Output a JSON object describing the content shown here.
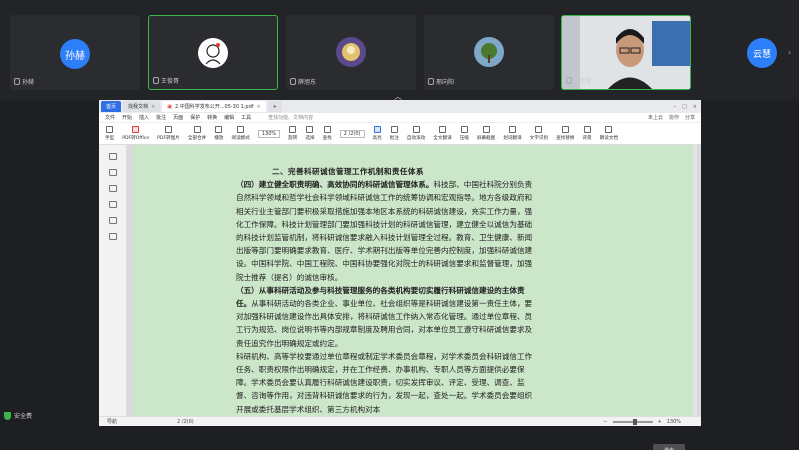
{
  "participants": [
    {
      "name": "孙赫",
      "avatar_text": "孙赫",
      "type": "initials"
    },
    {
      "name": "王俊哥",
      "type": "image"
    },
    {
      "name": "薛旭东",
      "type": "image"
    },
    {
      "name": "邢向阳",
      "type": "image"
    },
    {
      "name": "张金星",
      "type": "video",
      "active": true
    }
  ],
  "side_avatar": "云慧",
  "window": {
    "tabs": [
      "首页",
      "找我文档",
      "2.中国科学发布公开...05-30 1.pdf"
    ],
    "menu": [
      "文件",
      "开始",
      "插入",
      "批注",
      "页面",
      "保护",
      "转换",
      "编辑",
      "工具"
    ],
    "menu_highlight": "开始",
    "search_placeholder": "查找功能、文档内容",
    "menu_right": [
      "未上云",
      "协作",
      "分享"
    ],
    "toolbar": [
      {
        "label": "手型",
        "style": "plain"
      },
      {
        "label": "PDF转Office",
        "style": "red"
      },
      {
        "label": "PDF转图片",
        "style": "plain"
      },
      {
        "label": "全部合并",
        "style": "plain"
      },
      {
        "label": "播放",
        "style": "plain"
      },
      {
        "label": "阅读模式",
        "style": "plain"
      },
      {
        "label": "旋转",
        "style": "plain"
      },
      {
        "label": "选择",
        "style": "plain"
      },
      {
        "label": "查找",
        "style": "plain"
      },
      {
        "label": "高亮",
        "style": "blue"
      },
      {
        "label": "批注",
        "style": "plain"
      },
      {
        "label": "自动滚动",
        "style": "plain"
      },
      {
        "label": "全文翻译",
        "style": "plain"
      },
      {
        "label": "压缩",
        "style": "plain"
      },
      {
        "label": "屏幕截图",
        "style": "plain"
      },
      {
        "label": "划词翻译",
        "style": "plain"
      },
      {
        "label": "文字识别",
        "style": "plain"
      },
      {
        "label": "查找替换",
        "style": "plain"
      },
      {
        "label": "背景",
        "style": "plain"
      },
      {
        "label": "朗读文档",
        "style": "plain"
      }
    ],
    "zoom": "130%",
    "page_indicator": "2 /2(0)",
    "doc": {
      "heading": "二、完善科研诚信管理工作机制和责任体系",
      "para1_bold": "（四）建立健全职责明确、高效协同的科研诚信管理体系。",
      "para1": "科技部、中国社科院分别负责自然科学领域和哲学社会科学领域科研诚信工作的统筹协调和宏观指导。地方各级政府和相关行业主管部门要积极采取措施加强本地区本系统的科研诚信建设，充实工作力量，强化工作保障。科技计划管理部门要加强科技计划的科研诚信管理，建立健全以诚信为基础的科技计划监管机制，将科研诚信要求融入科技计划管理全过程。教育、卫生健康、新闻出版等部门要明确要求教育、医疗、学术期刊出版等单位完善内控制度，加强科研诚信建设。中国科学院、中国工程院、中国科协要强化对院士的科研诚信要求和监督管理，加强院士推荐（提名）的诚信审核。",
      "para2_bold": "（五）从事科研活动及参与科技管理服务的各类机构要切实履行科研诚信建设的主体责任。",
      "para2": "从事科研活动的各类企业、事业单位、社会组织等是科研诚信建设第一责任主体，要对加强科研诚信建设作出具体安排，将科研诚信工作纳入常态化管理。通过单位章程、员工行为规范、岗位说明书等内部规章制度及聘用合同，对本单位员工遵守科研诚信要求及责任追究作出明确规定或约定。",
      "para3": "科研机构、高等学校要通过单位章程或制定学术委员会章程，对学术委员会科研诚信工作任务、职责权限作出明确规定，并在工作经费、办事机构、专职人员等方面提供必要保障。学术委员会要认真履行科研诚信建设职责，切实发挥审议、评定、受理、调查、监督、咨询等作用，对违背科研诚信要求的行为，发现一起，查处一起。学术委员会要组织开展或委托基层学术组织、第三方机构对本"
    },
    "side_button": "退出",
    "status": {
      "left": "导航",
      "page": "2 /2(0)",
      "zoom": "130%"
    }
  },
  "secure_label": "安全费"
}
